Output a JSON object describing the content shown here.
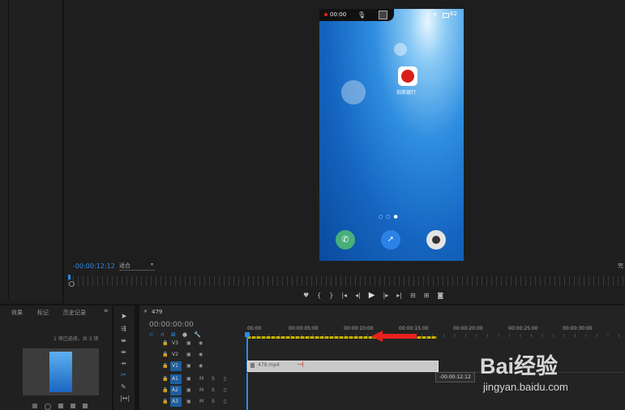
{
  "source_monitor": {
    "time_start": "-00:00:12:12",
    "fit_label": "适合",
    "right_label": "完"
  },
  "controls": [
    "marker-icon",
    "mark-in-icon",
    "mark-out-icon",
    "go-to-in-icon",
    "step-back-icon",
    "play-icon",
    "step-forward-icon",
    "go-to-out-icon",
    "lift-icon",
    "extract-icon",
    "camera-icon"
  ],
  "phone": {
    "rec_time": "00:00",
    "battery": "62",
    "app_label": "招商银行",
    "page_dots": [
      "○",
      "○",
      "●"
    ]
  },
  "project_panel": {
    "tabs": [
      "效果",
      "标记",
      "历史记录"
    ],
    "more": "»",
    "selection_info": "1 项已选择，共 3 项"
  },
  "timeline": {
    "sequence_name": "479",
    "timecode": "00:00:00:00",
    "ruler": [
      "00:00",
      "00:00:05:00",
      "00:00:10:00",
      "00:00:15:00",
      "00:00:20:00",
      "00:00:25:00",
      "00:00:30:00"
    ],
    "tracks": [
      {
        "name": "V3",
        "type": "video"
      },
      {
        "name": "V2",
        "type": "video"
      },
      {
        "name": "V1",
        "type": "video"
      },
      {
        "name": "A1",
        "type": "audio"
      },
      {
        "name": "A2",
        "type": "audio"
      },
      {
        "name": "A3",
        "type": "audio"
      }
    ],
    "clip_label": "479.mp4",
    "tooltip": "-00:00:12:12"
  },
  "watermark": {
    "brand": "Bai经验",
    "url": "jingyan.baidu.com"
  },
  "colors": {
    "accent_blue": "#2d8ceb",
    "arrow_red": "#e8211d",
    "work_area_yellow": "#c8b400"
  }
}
